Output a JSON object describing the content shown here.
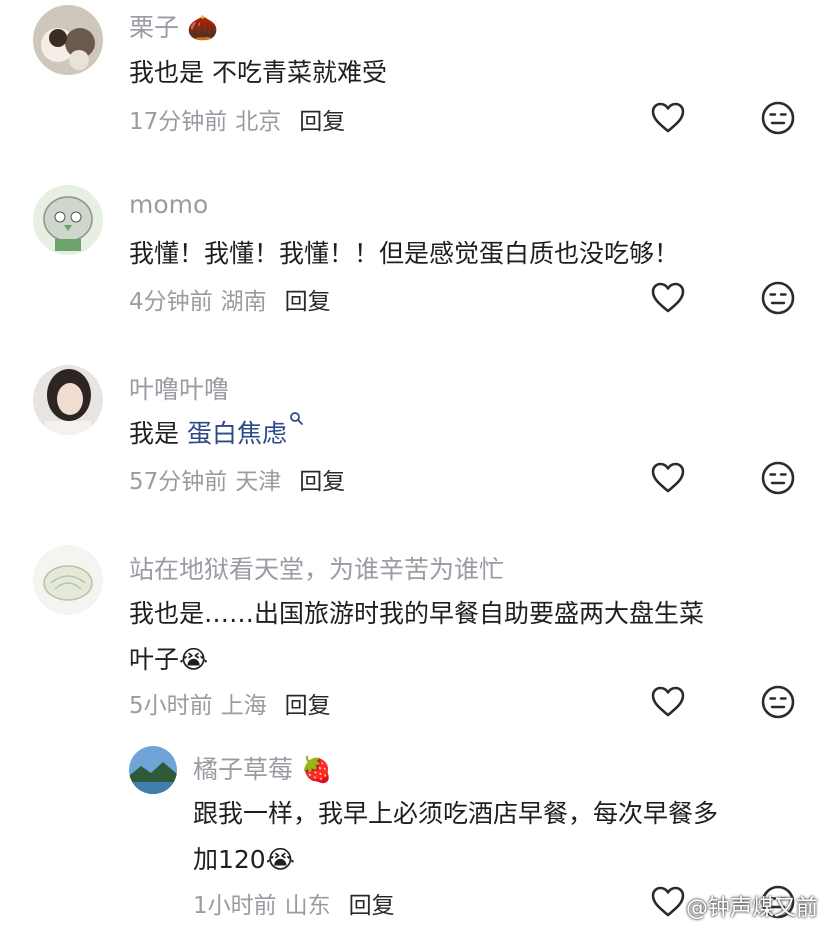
{
  "comments": [
    {
      "username": "栗子",
      "username_suffix": "🌰",
      "text": "我也是 不吃青菜就难受",
      "time": "17分钟前",
      "location": "北京",
      "reply_label": "回复"
    },
    {
      "username": "momo",
      "text": "我懂！我懂！我懂！！但是感觉蛋白质也没吃够！",
      "time": "4分钟前",
      "location": "湖南",
      "reply_label": "回复"
    },
    {
      "username": "叶噜叶噜",
      "text_prefix": "我是 ",
      "hashtag": "蛋白焦虑",
      "time": "57分钟前",
      "location": "天津",
      "reply_label": "回复"
    },
    {
      "username": "站在地狱看天堂，为谁辛苦为谁忙",
      "text_line1": "我也是……出国旅游时我的早餐自助要盛两大盘生菜",
      "text_line2": "叶子",
      "emoji": "😭",
      "time": "5小时前",
      "location": "上海",
      "reply_label": "回复"
    }
  ],
  "reply": {
    "username": "橘子草莓",
    "username_suffix": "🍓",
    "text_line1": "跟我一样，我早上必须吃酒店早餐，每次早餐多",
    "text_line2": "加120",
    "emoji": "😭",
    "time": "1小时前",
    "location": "山东",
    "reply_label": "回复"
  },
  "icons": {
    "like": "heart-outline-icon",
    "dislike": "neutral-face-icon"
  },
  "watermark": "@钟声煤又前"
}
